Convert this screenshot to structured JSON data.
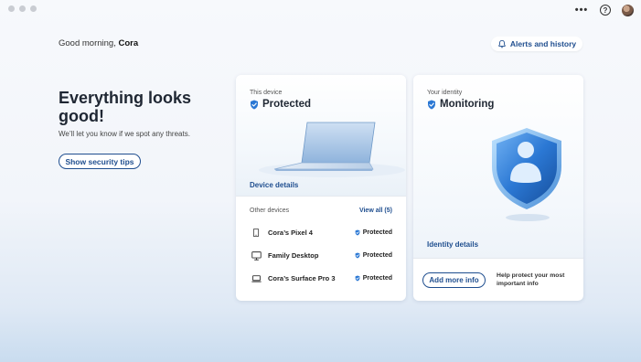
{
  "window": {
    "controls": [
      "close",
      "minimize",
      "maximize"
    ]
  },
  "topbar": {
    "more_icon": "more-horizontal-icon",
    "help_icon": "help-circle-icon",
    "more_label": "•••",
    "help_label": "?"
  },
  "greeting": {
    "prefix": "Good morning, ",
    "name": "Cora"
  },
  "alerts_button": {
    "label": "Alerts and history",
    "icon": "bell-icon"
  },
  "hero": {
    "headline": "Everything looks good!",
    "subtext": "We’ll let you know if we spot any threats.",
    "tips_button": "Show security tips"
  },
  "device_card": {
    "label": "This device",
    "status": "Protected",
    "details_link": "Device details",
    "other_devices_label": "Other devices",
    "view_all": "View all (5)",
    "devices": [
      {
        "name": "Cora’s Pixel 4",
        "icon": "phone-icon",
        "status": "Protected"
      },
      {
        "name": "Family Desktop",
        "icon": "desktop-icon",
        "status": "Protected"
      },
      {
        "name": "Cora’s Surface Pro 3",
        "icon": "laptop-icon",
        "status": "Protected"
      }
    ]
  },
  "identity_card": {
    "label": "Your identity",
    "status": "Monitoring",
    "details_link": "Identity details",
    "more_info_button": "Add more info",
    "help_text": "Help protect your most important info"
  },
  "colors": {
    "accent": "#1f4e8f",
    "shield": "#2b78d4"
  }
}
